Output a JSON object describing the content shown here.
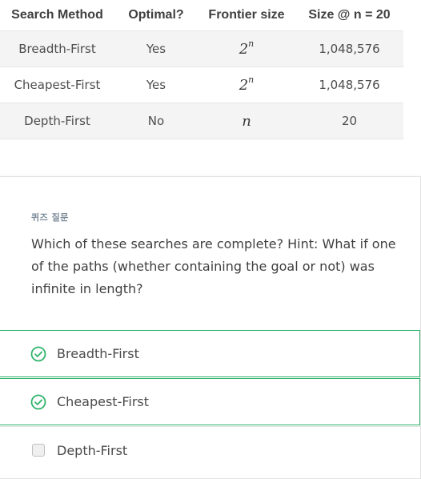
{
  "table": {
    "headers": [
      "Search Method",
      "Optimal?",
      "Frontier size",
      "Size @ n = 20"
    ],
    "rows": [
      {
        "method": "Breadth-First",
        "optimal": "Yes",
        "frontier_base": "2",
        "frontier_exp": "n",
        "size": "1,048,576"
      },
      {
        "method": "Cheapest-First",
        "optimal": "Yes",
        "frontier_base": "2",
        "frontier_exp": "n",
        "size": "1,048,576"
      },
      {
        "method": "Depth-First",
        "optimal": "No",
        "frontier_base": "n",
        "frontier_exp": "",
        "size": "20"
      }
    ]
  },
  "quiz": {
    "label": "퀴즈 질문",
    "question": "Which of these searches are complete? Hint: What if one of the paths (whether containing the goal or not) was infinite in length?",
    "options": [
      {
        "label": "Breadth-First",
        "state": "correct",
        "icon": "check-circle-icon"
      },
      {
        "label": "Cheapest-First",
        "state": "correct",
        "icon": "check-circle-icon"
      },
      {
        "label": "Depth-First",
        "state": "unchecked",
        "icon": "checkbox-icon"
      }
    ]
  },
  "colors": {
    "correct": "#2fb36b",
    "shade": "#f4f4f4",
    "label": "#7a8a99"
  }
}
